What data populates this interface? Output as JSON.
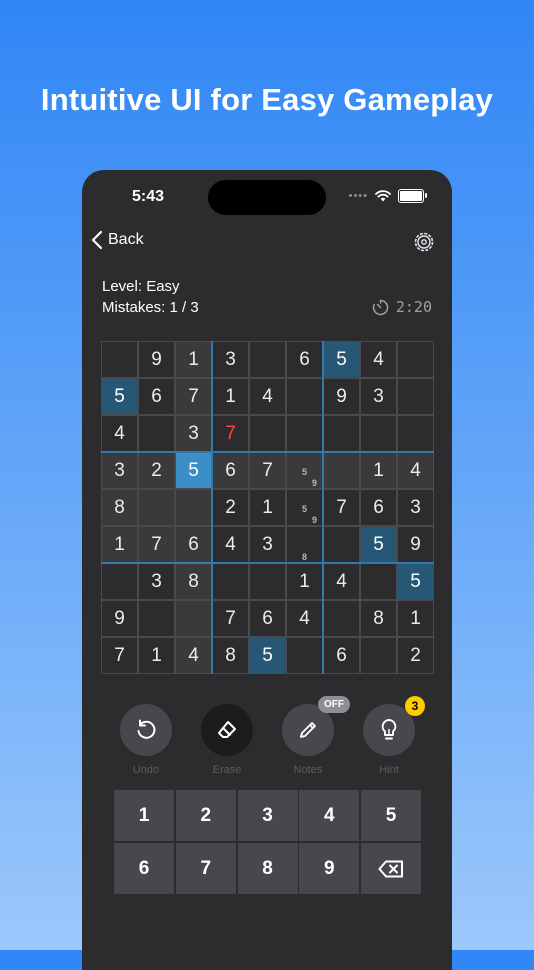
{
  "headline": "Intuitive UI for Easy Gameplay",
  "status": {
    "time": "5:43",
    "dots": "••••"
  },
  "nav": {
    "back_label": "Back"
  },
  "info": {
    "level": "Level: Easy",
    "mistakes": "Mistakes: 1 / 3",
    "timer": "2:20"
  },
  "board": {
    "values": [
      [
        "",
        "9",
        "1",
        "3",
        "",
        "6",
        "5",
        "4",
        ""
      ],
      [
        "5",
        "6",
        "7",
        "1",
        "4",
        "",
        "9",
        "3",
        ""
      ],
      [
        "4",
        "",
        "3",
        "7",
        "",
        "",
        "",
        "",
        ""
      ],
      [
        "3",
        "2",
        "5",
        "6",
        "7",
        "",
        "",
        "1",
        "4"
      ],
      [
        "8",
        "",
        "",
        "2",
        "1",
        "",
        "7",
        "6",
        "3"
      ],
      [
        "1",
        "7",
        "6",
        "4",
        "3",
        "",
        "",
        "5",
        "9"
      ],
      [
        "",
        "3",
        "8",
        "",
        "",
        "1",
        "4",
        "",
        "5"
      ],
      [
        "9",
        "",
        "",
        "7",
        "6",
        "4",
        "",
        "8",
        "1"
      ],
      [
        "7",
        "1",
        "4",
        "8",
        "5",
        "",
        "6",
        "",
        "2"
      ]
    ],
    "notes": {
      "3,5": [
        "5",
        "9"
      ],
      "4,5": [
        "5",
        "9"
      ],
      "5,5": [
        "8"
      ]
    }
  },
  "tools": {
    "undo": "Undo",
    "erase": "Erase",
    "notes": "Notes",
    "notes_state": "OFF",
    "hint": "Hint",
    "hint_count": "3"
  },
  "numpad": {
    "keys": [
      "1",
      "2",
      "3",
      "4",
      "5",
      "6",
      "7",
      "8",
      "9"
    ]
  },
  "colors": {
    "selected": "#3b8ec6",
    "same_number": "#265875",
    "highlight": "#3a3a3d",
    "error": "#ff453a",
    "badge": "#ffcc00"
  }
}
